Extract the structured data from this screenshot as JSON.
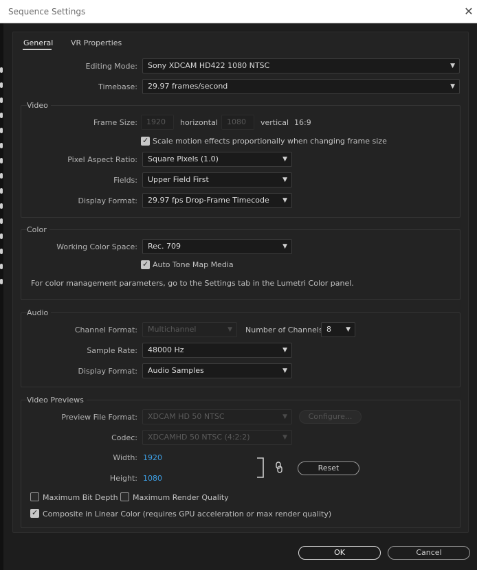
{
  "window": {
    "title": "Sequence Settings",
    "close_glyph": "✕"
  },
  "tabs": [
    {
      "label": "General",
      "active": true
    },
    {
      "label": "VR Properties",
      "active": false
    }
  ],
  "general": {
    "editing_mode_label": "Editing Mode:",
    "editing_mode_value": "Sony XDCAM HD422 1080 NTSC",
    "timebase_label": "Timebase:",
    "timebase_value": "29.97  frames/second"
  },
  "video": {
    "title": "Video",
    "frame_size_label": "Frame Size:",
    "width_value": "1920",
    "horizontal_label": "horizontal",
    "height_value": "1080",
    "vertical_label": "vertical",
    "aspect_text": "16:9",
    "scale_motion_label": "Scale motion effects proportionally when changing frame size",
    "scale_motion_checked": true,
    "pixel_aspect_label": "Pixel Aspect Ratio:",
    "pixel_aspect_value": "Square Pixels (1.0)",
    "fields_label": "Fields:",
    "fields_value": "Upper Field First",
    "display_format_label": "Display Format:",
    "display_format_value": "29.97 fps Drop-Frame Timecode"
  },
  "color": {
    "title": "Color",
    "working_space_label": "Working Color Space:",
    "working_space_value": "Rec. 709",
    "auto_tone_label": "Auto Tone Map Media",
    "auto_tone_checked": true,
    "info_text": "For color management parameters, go to the Settings tab in the Lumetri Color panel."
  },
  "audio": {
    "title": "Audio",
    "channel_format_label": "Channel Format:",
    "channel_format_value": "Multichannel",
    "num_channels_label": "Number of Channels:",
    "num_channels_value": "8",
    "sample_rate_label": "Sample Rate:",
    "sample_rate_value": "48000 Hz",
    "display_format_label": "Display Format:",
    "display_format_value": "Audio Samples"
  },
  "previews": {
    "title": "Video Previews",
    "file_format_label": "Preview File Format:",
    "file_format_value": "XDCAM HD 50 NTSC",
    "configure_label": "Configure...",
    "codec_label": "Codec:",
    "codec_value": "XDCAMHD 50 NTSC (4:2:2)",
    "width_label": "Width:",
    "width_value": "1920",
    "height_label": "Height:",
    "height_value": "1080",
    "reset_label": "Reset",
    "max_bit_depth_label": "Maximum Bit Depth",
    "max_bit_depth_checked": false,
    "max_render_quality_label": "Maximum Render Quality",
    "max_render_quality_checked": false,
    "composite_linear_label": "Composite in Linear Color (requires GPU acceleration or max render quality)",
    "composite_linear_checked": true
  },
  "footer": {
    "ok_label": "OK",
    "cancel_label": "Cancel"
  },
  "icons": {
    "chevron": "chevron-down-icon",
    "link": "link-icon",
    "close": "close-icon",
    "check": "checkmark-icon"
  }
}
